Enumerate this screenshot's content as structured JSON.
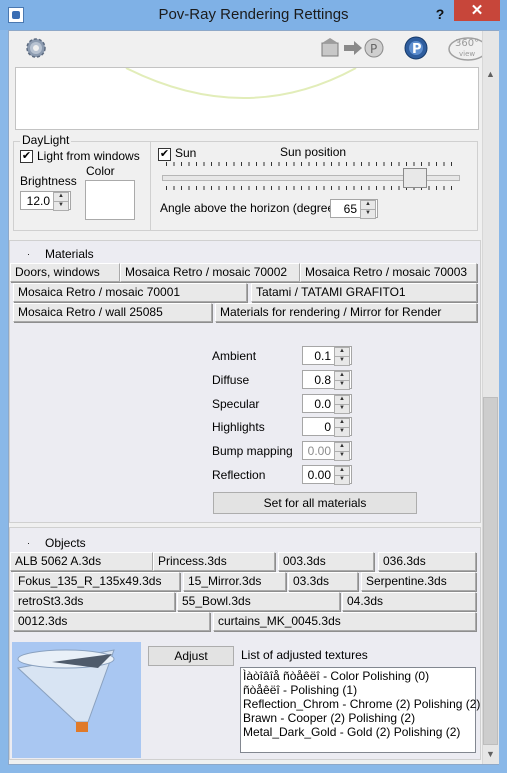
{
  "window": {
    "title": "Pov-Ray Rendering Rettings",
    "help": "?",
    "close": "✕"
  },
  "toolbar": {
    "view_360": "360°\nview"
  },
  "daylight": {
    "group_label": "DayLight",
    "light_from_windows": "Light from windows",
    "brightness_label": "Brightness",
    "brightness_value": "12.0",
    "color_label": "Color",
    "sun_label": "Sun",
    "sun_position_label": "Sun position",
    "sun_position_level": 0.88,
    "angle_label": "Angle above the horizon (degrees)",
    "angle_value": "65"
  },
  "materials": {
    "header": "Materials",
    "bullet": "·",
    "rows": [
      [
        "Doors, windows",
        "Mosaica Retro / mosaic 70002",
        "Mosaica Retro / mosaic 70003"
      ],
      [
        "Mosaica Retro / mosaic 70001",
        "Tatami / TATAMI GRAFITO1"
      ],
      [
        "Mosaica Retro / wall 25085",
        "Materials for rendering / Mirror for Render"
      ]
    ],
    "props": [
      {
        "label": "Ambient",
        "value": "0.1"
      },
      {
        "label": "Diffuse",
        "value": "0.8"
      },
      {
        "label": "Specular",
        "value": "0.0"
      },
      {
        "label": "Highlights",
        "value": "0"
      },
      {
        "label": "Bump mapping",
        "value": "0.00"
      },
      {
        "label": "Reflection",
        "value": "0.00"
      }
    ],
    "set_all": "Set for all materials"
  },
  "objects": {
    "header": "Objects",
    "bullet": "·",
    "rows": [
      [
        "ALB 5062 A.3ds",
        "Princess.3ds",
        "003.3ds",
        "036.3ds"
      ],
      [
        "Fokus_135_R_135x49.3ds",
        "15_Mirror.3ds",
        "03.3ds",
        "Serpentine.3ds"
      ],
      [
        "retroSt3.3ds",
        "55_Bowl.3ds",
        "04.3ds"
      ],
      [
        "0012.3ds",
        "curtains_MK_0045.3ds"
      ]
    ],
    "adjust": "Adjust",
    "textures_label": "List of adjusted textures",
    "textures": [
      "Ìàòîâîå ñòåêëî - Color Polishing (0)",
      "ñòåêëî - Polishing (1)",
      "Reflection_Chrom - Chrome (2) Polishing (2)",
      "Brawn - Cooper (2) Polishing (2)",
      "Metal_Dark_Gold - Gold (2) Polishing (2)"
    ]
  }
}
